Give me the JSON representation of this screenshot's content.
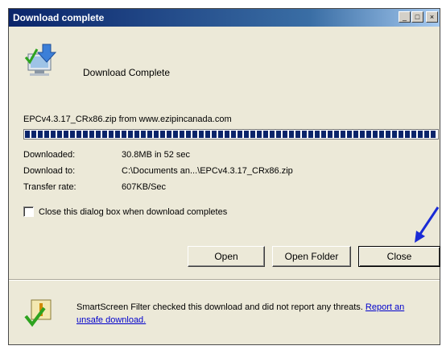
{
  "window": {
    "title": "Download complete",
    "minimize_glyph": "_",
    "maximize_glyph": "□",
    "close_glyph": "×"
  },
  "header": {
    "icon": "computer-download-icon",
    "text": "Download Complete"
  },
  "download": {
    "file_line": "EPCv4.3.17_CRx86.zip from www.ezipincanada.com",
    "progress_percent": 100,
    "downloaded_label": "Downloaded:",
    "downloaded_value": "30.8MB in 52 sec",
    "download_to_label": "Download to:",
    "download_to_value": "C:\\Documents an...\\EPCv4.3.17_CRx86.zip",
    "transfer_rate_label": "Transfer rate:",
    "transfer_rate_value": "607KB/Sec"
  },
  "options": {
    "close_when_complete_label": "Close this dialog box when download completes",
    "close_when_complete_checked": false
  },
  "buttons": {
    "open": "Open",
    "open_folder": "Open Folder",
    "close": "Close"
  },
  "footer": {
    "icon": "shield-check-icon",
    "text": "SmartScreen Filter checked this download and did not report any threats.",
    "link": "Report an unsafe download."
  },
  "colors": {
    "title_bar": "#0a246a",
    "progress": "#0a246a",
    "arrow": "#1a2bd6",
    "link": "#0000cc"
  }
}
